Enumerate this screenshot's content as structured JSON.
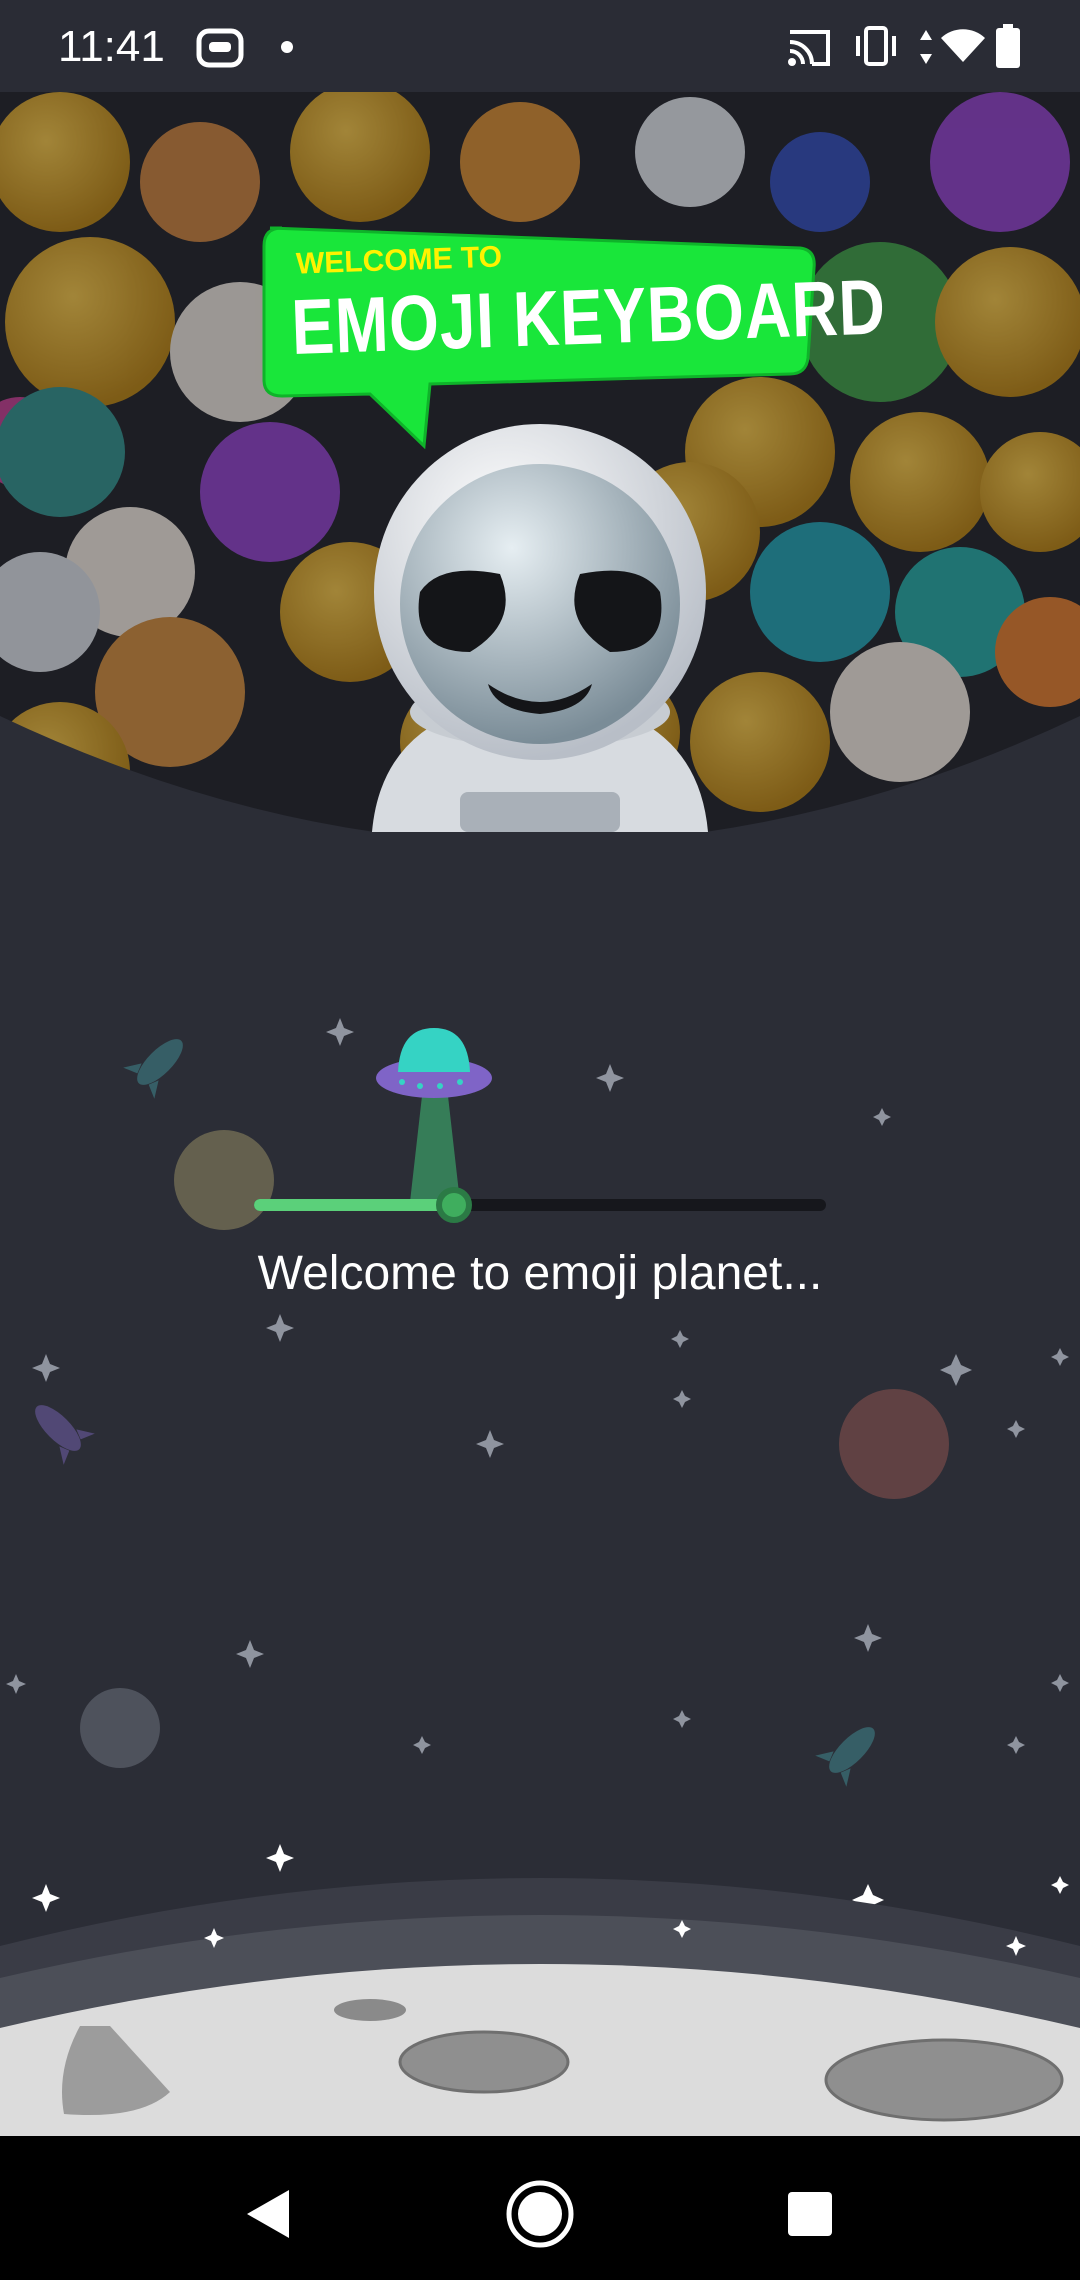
{
  "status_bar": {
    "time": "11:41",
    "icons": [
      "assistant-icon",
      "notification-dot-icon",
      "cast-icon",
      "vibrate-icon",
      "data-arrows-icon",
      "wifi-icon",
      "battery-icon"
    ]
  },
  "hero": {
    "badge_small": "WELCOME TO",
    "badge_big": "EMOJI KEYBOARD",
    "mascot": "alien-astronaut-icon"
  },
  "loading": {
    "progress_fraction": 0.35,
    "text": "Welcome to emoji planet..."
  },
  "nav_bar": {
    "icons": [
      "back-icon",
      "home-icon",
      "recents-icon"
    ]
  },
  "colors": {
    "background": "#2b2d36",
    "accent_green": "#5bd07a",
    "badge_green": "#19e63a",
    "badge_yellow": "#fff200"
  }
}
